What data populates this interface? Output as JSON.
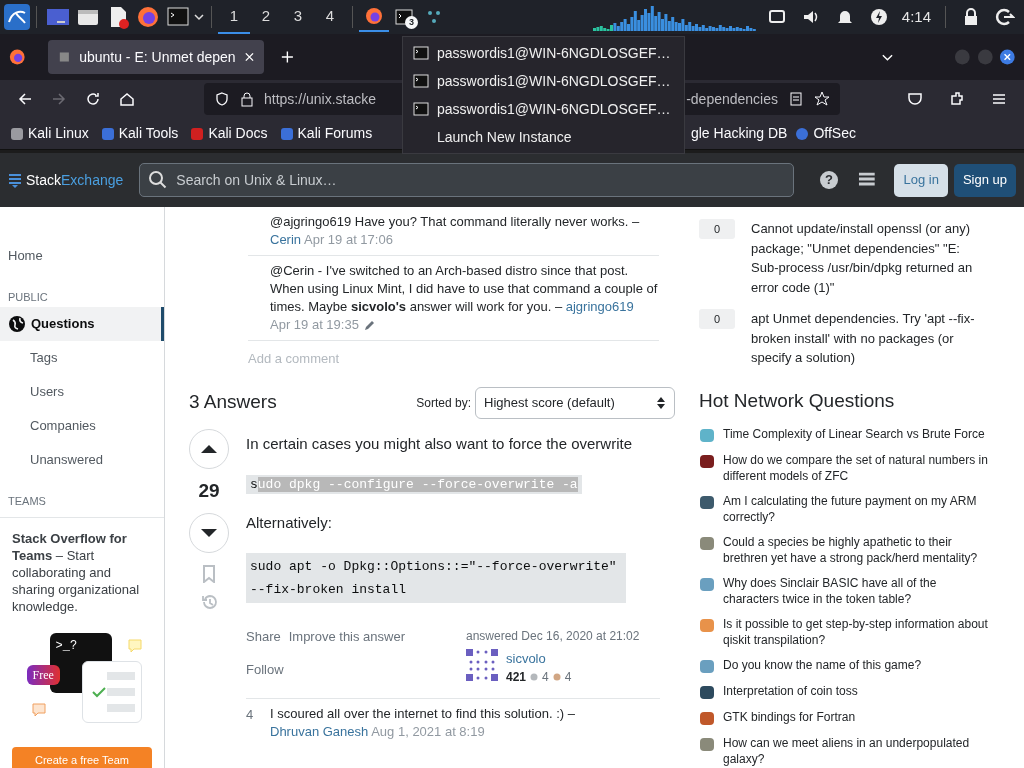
{
  "taskbar": {
    "workspaces": [
      {
        "label": "1",
        "selected": true
      },
      {
        "label": "2",
        "selected": false
      },
      {
        "label": "3",
        "selected": false
      },
      {
        "label": "4",
        "selected": false
      }
    ],
    "terminal_badge": "3",
    "clock": "4:14"
  },
  "browser": {
    "tab_title": "ubuntu - E: Unmet depen",
    "url_start": "https://unix.stacke",
    "url_end": "-dependencies",
    "bookmarks_left": [
      "Kali Linux",
      "Kali Tools",
      "Kali Docs",
      "Kali Forums"
    ],
    "bookmarks_right": [
      "gle Hacking DB",
      "OffSec"
    ]
  },
  "window_menu": {
    "items": [
      {
        "label": "passwordis1@WIN-6NGDLOSGEF…",
        "kind": "window"
      },
      {
        "label": "passwordis1@WIN-6NGDLOSGEF…",
        "kind": "window"
      },
      {
        "label": "passwordis1@WIN-6NGDLOSGEF…",
        "kind": "window"
      },
      {
        "label": "Launch New Instance",
        "kind": "action"
      }
    ]
  },
  "site_header": {
    "logo_left": "Stack",
    "logo_right": "Exchange",
    "search_placeholder": "Search on Unix & Linux…",
    "help_label": "?",
    "buttons": [
      {
        "label": "Log in",
        "kind": "secondary"
      },
      {
        "label": "Sign up",
        "kind": "primary"
      }
    ]
  },
  "sidebar": {
    "home": {
      "label": "Home",
      "selected": false
    },
    "public_heading": "PUBLIC",
    "items": [
      {
        "label": "Questions",
        "kind": "main",
        "selected": true
      },
      {
        "label": "Tags",
        "kind": "sub",
        "selected": false
      },
      {
        "label": "Users",
        "kind": "sub",
        "selected": false
      },
      {
        "label": "Companies",
        "kind": "sub",
        "selected": false
      },
      {
        "label": "Unanswered",
        "kind": "sub",
        "selected": false
      }
    ],
    "teams_heading": "TEAMS",
    "teams_promo": {
      "text": "**Stack Overflow for Teams** – Start collaborating and sharing organizational knowledge.",
      "prompt": ">_?",
      "badge": "Free",
      "button": "Create a free Team"
    }
  },
  "question_comments": [
    {
      "text": "@ajgringo619 Have you? That command literally never works.",
      "dash": "–",
      "author": "Cerin",
      "date": "Apr 19 at 17:06",
      "edited": false
    },
    {
      "text": "@Cerin - I've switched to an Arch-based distro since that post. When using Linux Mint, I did have to use that command a couple of times. Maybe **sicvolo's** answer will work for you.",
      "dash": "–",
      "author": "ajgringo619",
      "date": "Apr 19 at 19:35",
      "edited": true
    }
  ],
  "add_comment": "Add a comment",
  "answers_header": {
    "title": "3 Answers",
    "sort_label": "Sorted by:",
    "sort_value": "Highest score (default)"
  },
  "answer": {
    "score": "29",
    "body": [
      {
        "kind": "text",
        "text": "In certain cases you might also want to force the overwrite"
      },
      {
        "kind": "code",
        "segments": [
          {
            "text": "s",
            "selected": false
          },
          {
            "text": "udo dpkg --configure --force-overwrite -a",
            "selected": true
          }
        ]
      },
      {
        "kind": "text",
        "text": "Alternatively:"
      },
      {
        "kind": "code",
        "segments": [
          {
            "text": "sudo apt -o Dpkg::Options::=\"--force-overwrite\" --fix-broken install",
            "selected": false
          }
        ]
      }
    ],
    "actions": [
      "Share",
      "Improve this answer",
      "Follow"
    ],
    "answered": "answered Dec 16, 2020 at 21:02",
    "user": "sicvolo",
    "reputation": "421",
    "silver": "4",
    "bronze": "4",
    "comments": [
      {
        "score": "4",
        "text": "I scoured all over the internet to find this solution. :)",
        "dash": "–",
        "author": "Dhruvan Ganesh",
        "date": "Aug 1, 2021 at 8:19"
      }
    ]
  },
  "related": [
    {
      "score": "0",
      "title": "Cannot update/install openssl (or any) package; \"Unmet dependencies\" \"E: Sub-process /usr/bin/dpkg returned an error code (1)\""
    },
    {
      "score": "0",
      "title": "apt Unmet dependencies. Try 'apt --fix-broken install' with no packages (or specify a solution)"
    }
  ],
  "hot_network": {
    "heading": "Hot Network Questions",
    "items": [
      {
        "title": "Time Complexity of Linear Search vs Brute Force",
        "color": "#5fb3c9"
      },
      {
        "title": "How do we compare the set of natural numbers in different models of ZFC",
        "color": "#7a1e1e"
      },
      {
        "title": "Am I calculating the future payment on my ARM correctly?",
        "color": "#3d5a6c"
      },
      {
        "title": "Could a species be highly apathetic to their brethren yet have a strong pack/herd mentality?",
        "color": "#8a8a7a"
      },
      {
        "title": "Why does Sinclair BASIC have all of the characters twice in the token table?",
        "color": "#6a9fbf"
      },
      {
        "title": "Is it possible to get step-by-step information about qiskit transpilation?",
        "color": "#e8924a"
      },
      {
        "title": "Do you know the name of this game?",
        "color": "#6a9fbf"
      },
      {
        "title": "Interpretation of coin toss",
        "color": "#2d4a5e"
      },
      {
        "title": "GTK bindings for Fortran",
        "color": "#c0582a"
      },
      {
        "title": "How can we meet aliens in an underpopulated galaxy?",
        "color": "#8a8a7a"
      }
    ]
  }
}
